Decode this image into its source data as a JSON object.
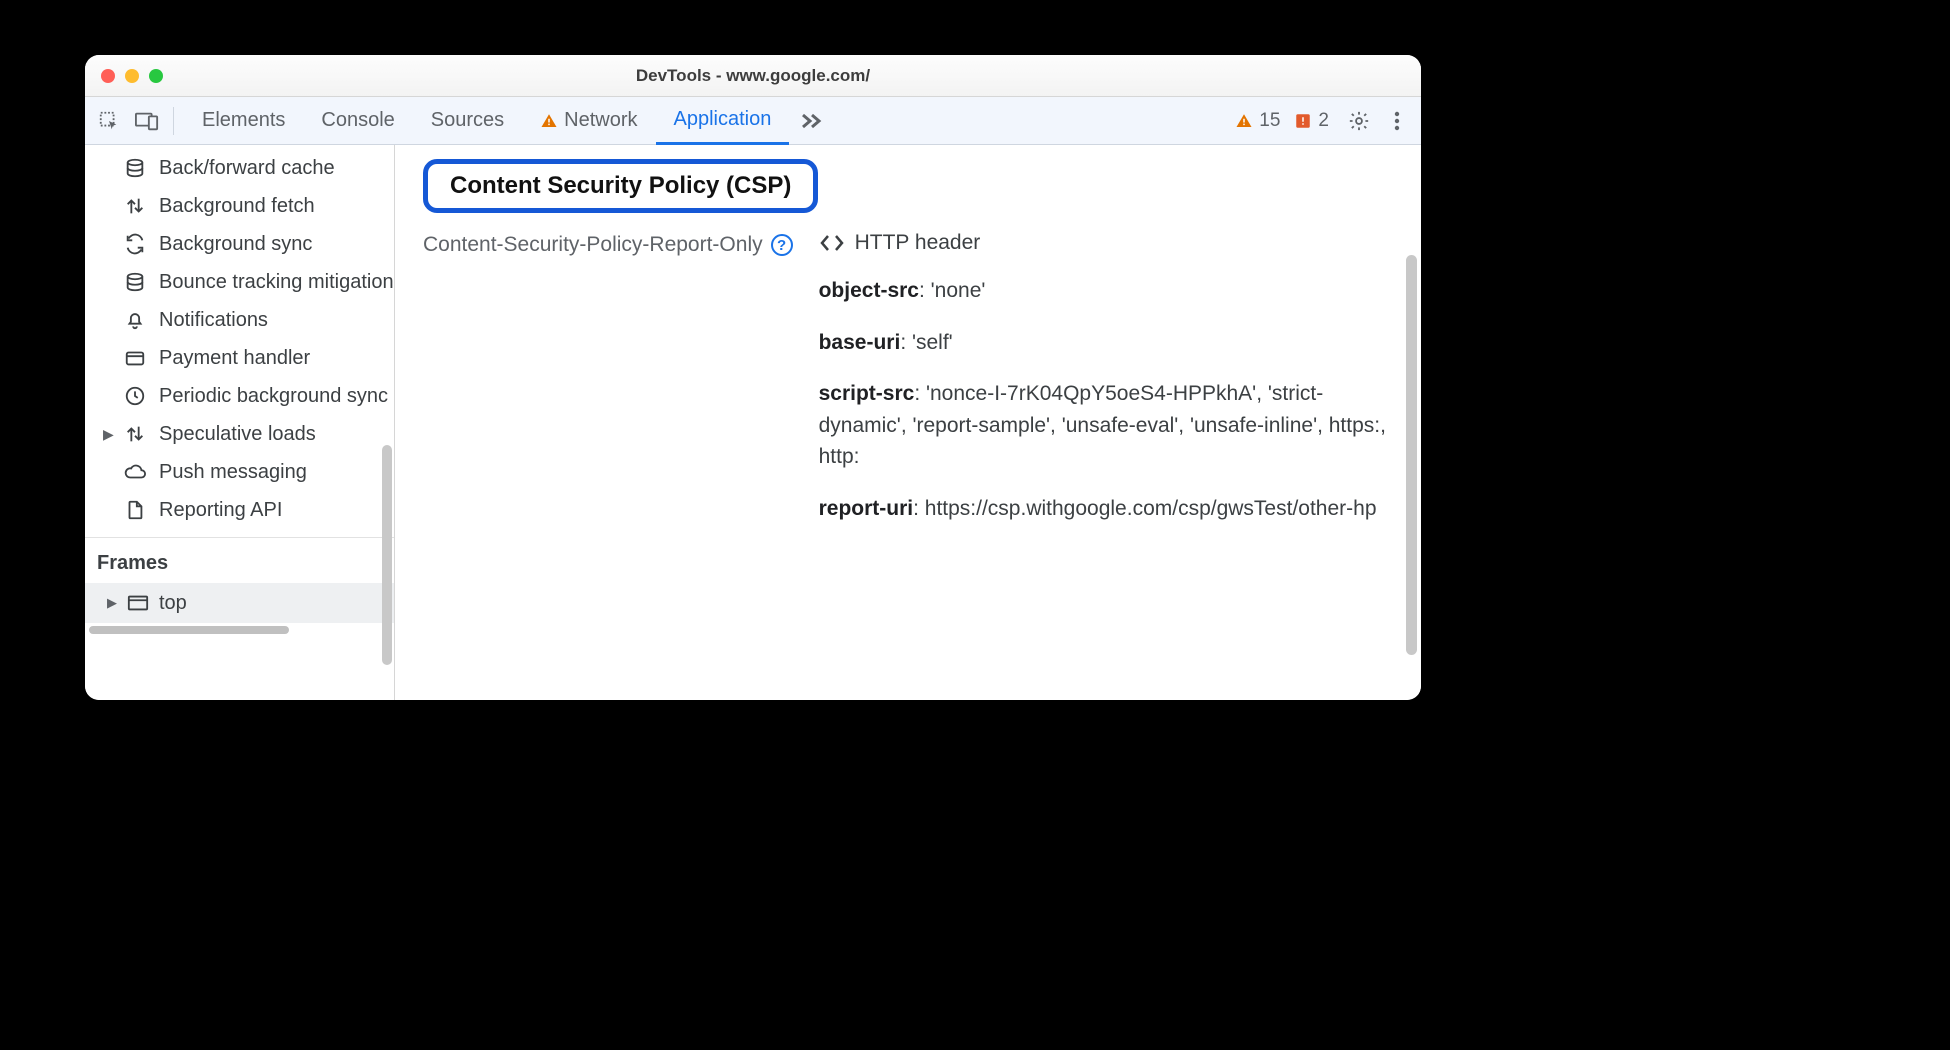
{
  "window": {
    "title": "DevTools - www.google.com/"
  },
  "tabstrip": {
    "tabs": [
      "Elements",
      "Console",
      "Sources",
      "Network",
      "Application"
    ],
    "active": "Application",
    "warn_count": "15",
    "issue_count": "2"
  },
  "sidebar": {
    "items": [
      {
        "icon": "database",
        "label": "Back/forward cache"
      },
      {
        "icon": "updown",
        "label": "Background fetch"
      },
      {
        "icon": "sync",
        "label": "Background sync"
      },
      {
        "icon": "database",
        "label": "Bounce tracking mitigation"
      },
      {
        "icon": "bell",
        "label": "Notifications"
      },
      {
        "icon": "card",
        "label": "Payment handler"
      },
      {
        "icon": "clock",
        "label": "Periodic background sync"
      },
      {
        "icon": "updown",
        "label": "Speculative loads",
        "expandable": true
      },
      {
        "icon": "cloud",
        "label": "Push messaging"
      },
      {
        "icon": "file",
        "label": "Reporting API"
      }
    ],
    "frames_header": "Frames",
    "frame_top": "top"
  },
  "main": {
    "heading": "Content Security Policy (CSP)",
    "policy_label": "Content-Security-Policy-Report-Only",
    "source": "HTTP header",
    "directives": [
      {
        "name": "object-src",
        "value": ": 'none'"
      },
      {
        "name": "base-uri",
        "value": ": 'self'"
      },
      {
        "name": "script-src",
        "value": ": 'nonce-I-7rK04QpY5oeS4-HPPkhA', 'strict-dynamic', 'report-sample', 'unsafe-eval', 'unsafe-inline', https:, http:"
      },
      {
        "name": "report-uri",
        "value": ": https://csp.withgoogle.com/csp/gwsTest/other-hp"
      }
    ]
  }
}
